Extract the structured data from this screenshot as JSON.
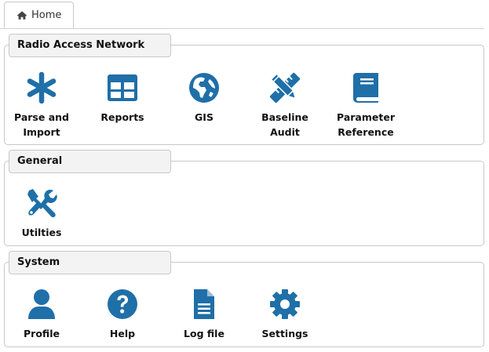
{
  "tabs": {
    "home": {
      "label": "Home",
      "icon": "home-icon"
    }
  },
  "colors": {
    "icon_blue": "#1f6fa8",
    "panel_header_bg": "#f3f3f3",
    "border": "#c8c8c8"
  },
  "sections": {
    "ran": {
      "title": "Radio Access Network",
      "items": [
        {
          "label": "Parse and\nImport",
          "icon": "asterisk-icon"
        },
        {
          "label": "Reports",
          "icon": "table-icon"
        },
        {
          "label": "GIS",
          "icon": "globe-icon"
        },
        {
          "label": "Baseline\nAudit",
          "icon": "pencil-ruler-icon"
        },
        {
          "label": "Parameter\nReference",
          "icon": "book-icon"
        }
      ]
    },
    "general": {
      "title": "General",
      "items": [
        {
          "label": "Utilties",
          "icon": "tools-icon"
        }
      ]
    },
    "system": {
      "title": "System",
      "items": [
        {
          "label": "Profile",
          "icon": "user-icon"
        },
        {
          "label": "Help",
          "icon": "question-circle-icon"
        },
        {
          "label": "Log file",
          "icon": "file-text-icon"
        },
        {
          "label": "Settings",
          "icon": "cog-icon"
        }
      ]
    }
  }
}
